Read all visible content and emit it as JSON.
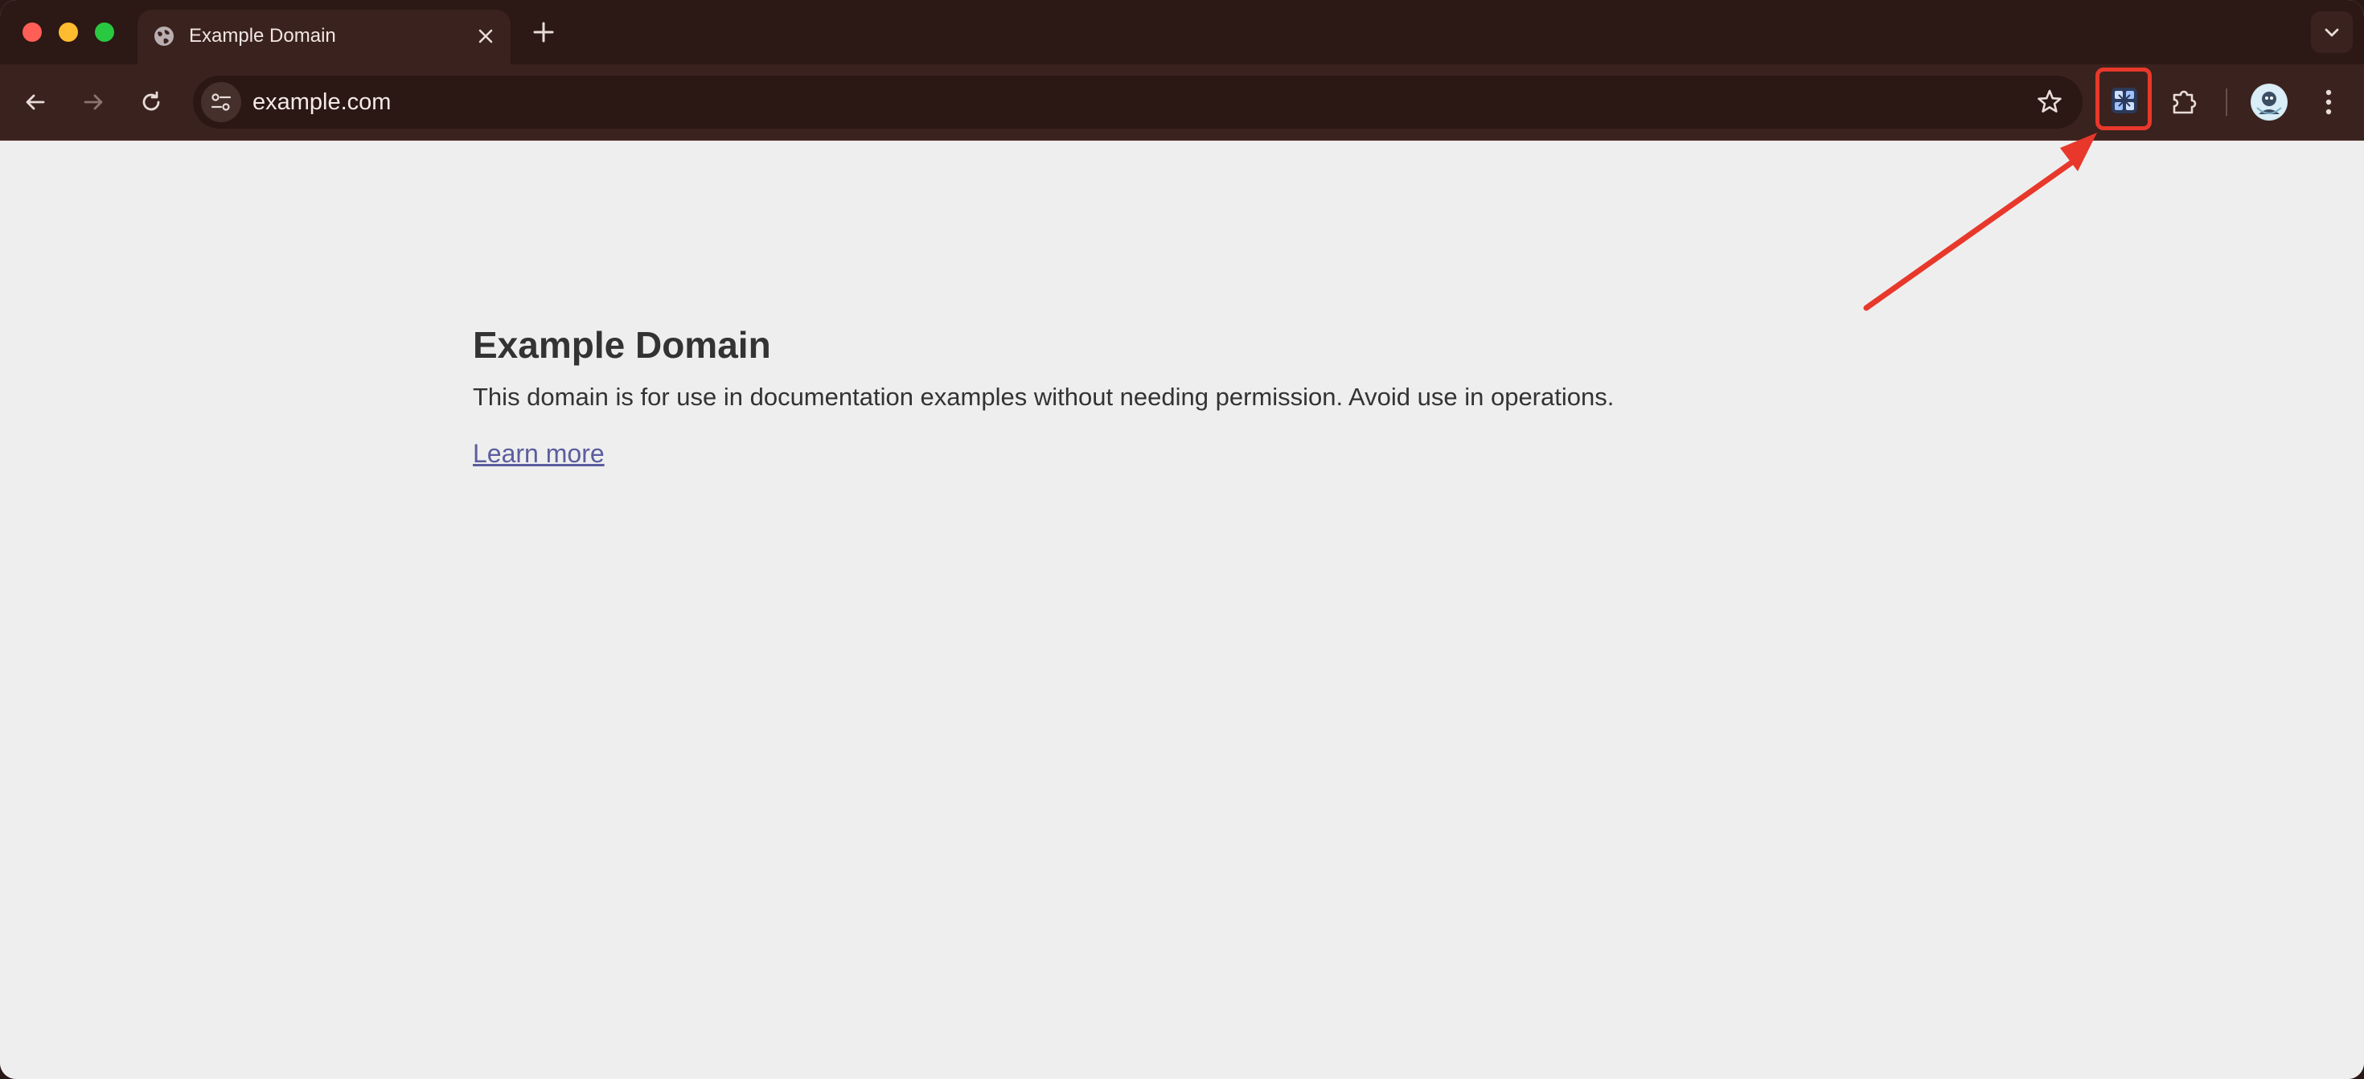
{
  "tab": {
    "title": "Example Domain",
    "favicon": "globe-icon"
  },
  "toolbar": {
    "url": "example.com",
    "highlighted_extension": "extension-app-icon"
  },
  "page": {
    "heading": "Example Domain",
    "paragraph": "This domain is for use in documentation examples without needing permission. Avoid use in operations.",
    "link": "Learn more"
  },
  "annotation": {
    "color": "#e8382b"
  }
}
